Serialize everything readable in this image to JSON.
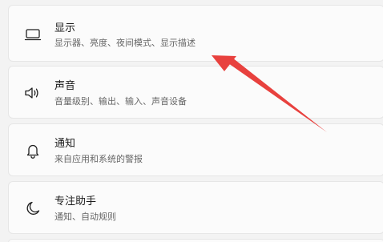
{
  "settings_items": [
    {
      "title": "显示",
      "description": "显示器、亮度、夜间模式、显示描述",
      "icon": "monitor-icon"
    },
    {
      "title": "声音",
      "description": "音量级别、输出、输入、声音设备",
      "icon": "speaker-icon"
    },
    {
      "title": "通知",
      "description": "来自应用和系统的警报",
      "icon": "bell-icon"
    },
    {
      "title": "专注助手",
      "description": "通知、自动规则",
      "icon": "moon-icon"
    }
  ],
  "annotation": {
    "type": "arrow",
    "color": "#e8413e",
    "points_to": "显示"
  },
  "colors": {
    "card_background": "#fbfbfb",
    "page_background": "#f3f3f3"
  }
}
